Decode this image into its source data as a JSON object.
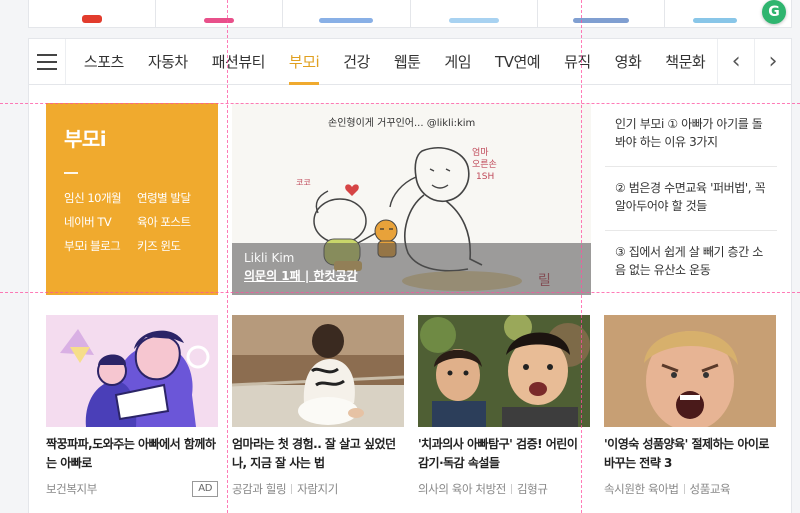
{
  "top_strip": {
    "colors": [
      "#e23c2d",
      "#e8508a",
      "#3a7bd5",
      "#3f9be0",
      "#2c5fb3",
      "#2fb56f"
    ]
  },
  "grammarly_badge": {
    "letter": "G"
  },
  "nav": {
    "menu_icon": "hamburger-menu-icon",
    "items": [
      "스포츠",
      "자동차",
      "패션뷰티",
      "부모i",
      "건강",
      "웹툰",
      "게임",
      "TV연예",
      "뮤직",
      "영화",
      "책문화"
    ],
    "active_index": 3,
    "prev_arrow": "‹",
    "next_arrow": "›"
  },
  "brand": {
    "title": "부모i",
    "links": [
      "임신 10개월",
      "연령별 발달",
      "네이버 TV",
      "육아 포스트",
      "부모i 블로그",
      "키즈 윈도"
    ],
    "color": "#f0aa2e"
  },
  "hero": {
    "handwriting": "손인형이게 거꾸인어... @likli:kim",
    "author": "Likli Kim",
    "title": "의문의 1패 | 한컷공감"
  },
  "popular": [
    "인기 부모i ① 아빠가 아기를 돌봐야 하는 이유 3가지",
    "② 범은경 수면교육 '퍼버법', 꼭 알아두어야 할 것들",
    "③ 집에서 쉽게 살 빼기 층간 소음 없는 유산소 운동"
  ],
  "cards": [
    {
      "title": "짝꿍파파,도와주는 아빠에서 함께하는 아빠로",
      "meta": [
        "보건복지부"
      ],
      "ad": "AD"
    },
    {
      "title": "엄마라는 첫 경험.. 잘 살고 싶었던 나, 지금 잘 사는 법",
      "meta": [
        "공감과 힐링",
        "자람지기"
      ]
    },
    {
      "title": "'치과의사 아빠탐구' 검증! 어린이 감기·독감 속설들",
      "meta": [
        "의사의 육아 처방전",
        "김형규"
      ]
    },
    {
      "title": "'이영숙 성품양육' 절제하는 아이로 바꾸는 전략 3",
      "meta": [
        "속시원한 육아법",
        "성품교육"
      ]
    }
  ]
}
